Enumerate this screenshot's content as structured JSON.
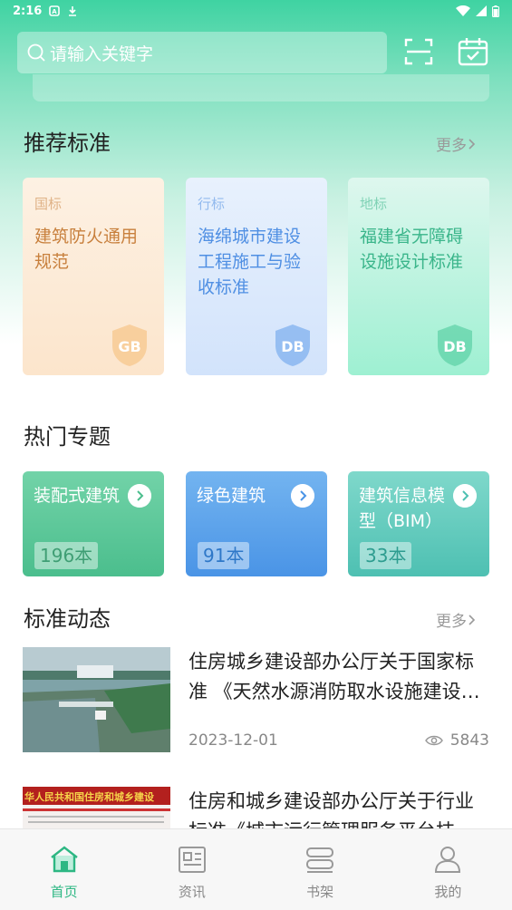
{
  "status_bar": {
    "time": "2:16"
  },
  "search": {
    "placeholder": "请输入关键字"
  },
  "recommended": {
    "title": "推荐标准",
    "more": "更多",
    "cards": [
      {
        "tag": "国标",
        "name": "建筑防火通用规范",
        "badge": "GB"
      },
      {
        "tag": "行标",
        "name": "海绵城市建设工程施工与验收标准",
        "badge": "DB"
      },
      {
        "tag": "地标",
        "name": "福建省无障碍设施设计标准",
        "badge": "DB"
      }
    ]
  },
  "topics": {
    "title": "热门专题",
    "cards": [
      {
        "title": "装配式建筑",
        "count": "196本"
      },
      {
        "title": "绿色建筑",
        "count": "91本"
      },
      {
        "title": "建筑信息模型（BIM）",
        "count": "33本"
      }
    ]
  },
  "news": {
    "title": "标准动态",
    "more": "更多",
    "items": [
      {
        "title": "住房城乡建设部办公厅关于国家标准 《天然水源消防取水设施建设…",
        "date": "2023-12-01",
        "views": "5843"
      },
      {
        "title": "住房和城乡建设部办公厅关于行业标准《城市运行管理服务平台技",
        "thumb_text": "华人民共和国住房和城乡建设"
      }
    ]
  },
  "tabs": [
    {
      "label": "首页",
      "icon": "home-icon",
      "active": true
    },
    {
      "label": "资讯",
      "icon": "news-icon",
      "active": false
    },
    {
      "label": "书架",
      "icon": "bookshelf-icon",
      "active": false
    },
    {
      "label": "我的",
      "icon": "profile-icon",
      "active": false
    }
  ],
  "colors": {
    "accent": "#2db783",
    "header_green": "#3fd3a2"
  }
}
